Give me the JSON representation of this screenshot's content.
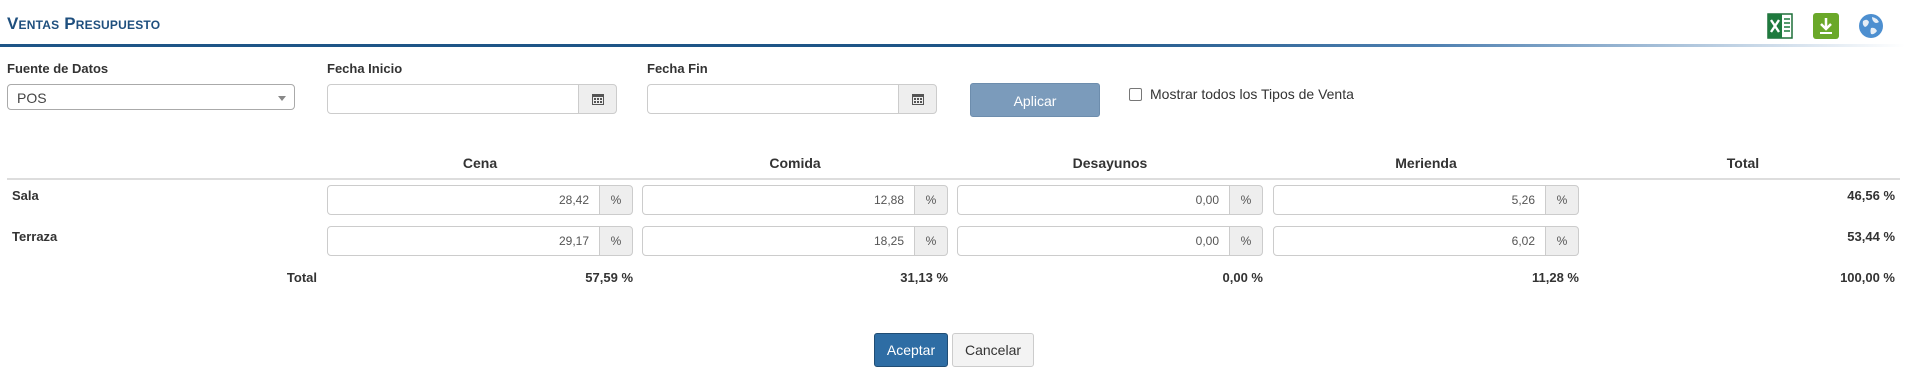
{
  "page": {
    "title": "Ventas Presupuesto"
  },
  "header_icons": [
    "excel-icon",
    "download-icon",
    "globe-icon"
  ],
  "filters": {
    "source_label": "Fuente de Datos",
    "source_value": "POS",
    "start_label": "Fecha Inicio",
    "start_value": "",
    "end_label": "Fecha Fin",
    "end_value": "",
    "apply_label": "Aplicar",
    "show_all_label": "Mostrar todos los Tipos de Venta",
    "show_all_checked": false
  },
  "table": {
    "columns": [
      "Cena",
      "Comida",
      "Desayunos",
      "Merienda",
      "Total"
    ],
    "unit": "%",
    "rows": [
      {
        "label": "Sala",
        "values": [
          "28,42",
          "12,88",
          "0,00",
          "5,26"
        ],
        "total": "46,56 %"
      },
      {
        "label": "Terraza",
        "values": [
          "29,17",
          "18,25",
          "0,00",
          "6,02"
        ],
        "total": "53,44 %"
      }
    ],
    "footer": {
      "label": "Total",
      "values": [
        "57,59 %",
        "31,13 %",
        "0,00 %",
        "11,28 %"
      ],
      "total": "100,00 %"
    }
  },
  "actions": {
    "accept_label": "Aceptar",
    "cancel_label": "Cancelar"
  },
  "colors": {
    "primary": "#2e6da4",
    "title": "#1e4f7e",
    "apply": "#7b9bbb"
  }
}
